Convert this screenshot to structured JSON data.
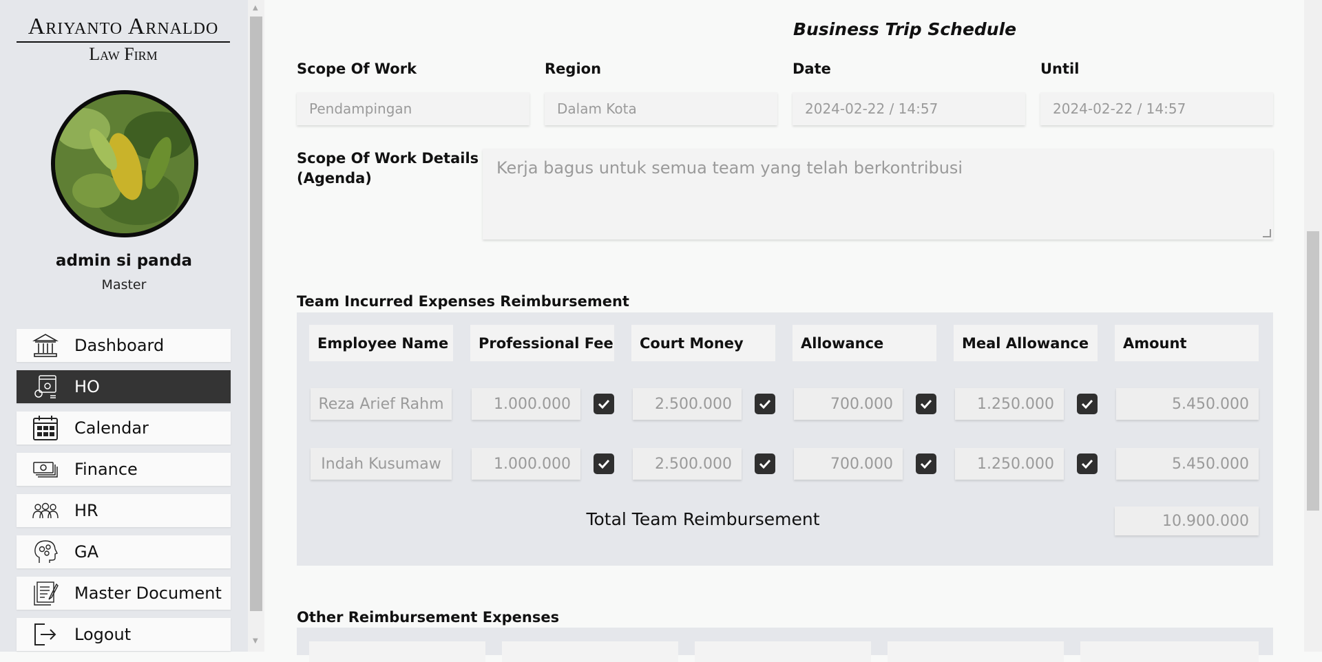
{
  "brand": {
    "line1": "Ariyanto Arnaldo",
    "line2": "Law Firm"
  },
  "user": {
    "name": "admin si panda",
    "role": "Master"
  },
  "nav": [
    {
      "label": "Dashboard",
      "icon": "bank-icon",
      "active": false
    },
    {
      "label": "HO",
      "icon": "office-settings-icon",
      "active": true
    },
    {
      "label": "Calendar",
      "icon": "calendar-icon",
      "active": false
    },
    {
      "label": "Finance",
      "icon": "money-icon",
      "active": false
    },
    {
      "label": "HR",
      "icon": "people-icon",
      "active": false
    },
    {
      "label": "GA",
      "icon": "head-gears-icon",
      "active": false
    },
    {
      "label": "Master Document",
      "icon": "document-icon",
      "active": false
    },
    {
      "label": "Logout",
      "icon": "logout-icon",
      "active": false
    }
  ],
  "trip": {
    "title": "Business Trip Schedule",
    "fields": [
      {
        "label": "Scope Of Work",
        "value": "Pendampingan"
      },
      {
        "label": "Region",
        "value": "Dalam Kota"
      },
      {
        "label": "Date",
        "value": "2024-02-22 / 14:57"
      },
      {
        "label": "Until",
        "value": "2024-02-22 / 14:57"
      }
    ],
    "details_label_1": "Scope Of Work Details",
    "details_label_2": "(Agenda)",
    "details_value": "Kerja bagus untuk semua team yang telah berkontribusi"
  },
  "team": {
    "title": "Team Incurred Expenses Reimbursement",
    "headers": [
      "Employee Name",
      "Professional Fee",
      "Court Money",
      "Allowance",
      "Meal Allowance",
      "Amount"
    ],
    "rows": [
      {
        "name": "Reza Arief Rahm",
        "fee": "1.000.000",
        "court": "2.500.000",
        "allowance": "700.000",
        "meal": "1.250.000",
        "amount": "5.450.000"
      },
      {
        "name": "Indah Kusumaw",
        "fee": "1.000.000",
        "court": "2.500.000",
        "allowance": "700.000",
        "meal": "1.250.000",
        "amount": "5.450.000"
      }
    ],
    "total_label": "Total Team Reimbursement",
    "total_value": "10.900.000"
  },
  "other": {
    "title": "Other Reimbursement Expenses"
  }
}
